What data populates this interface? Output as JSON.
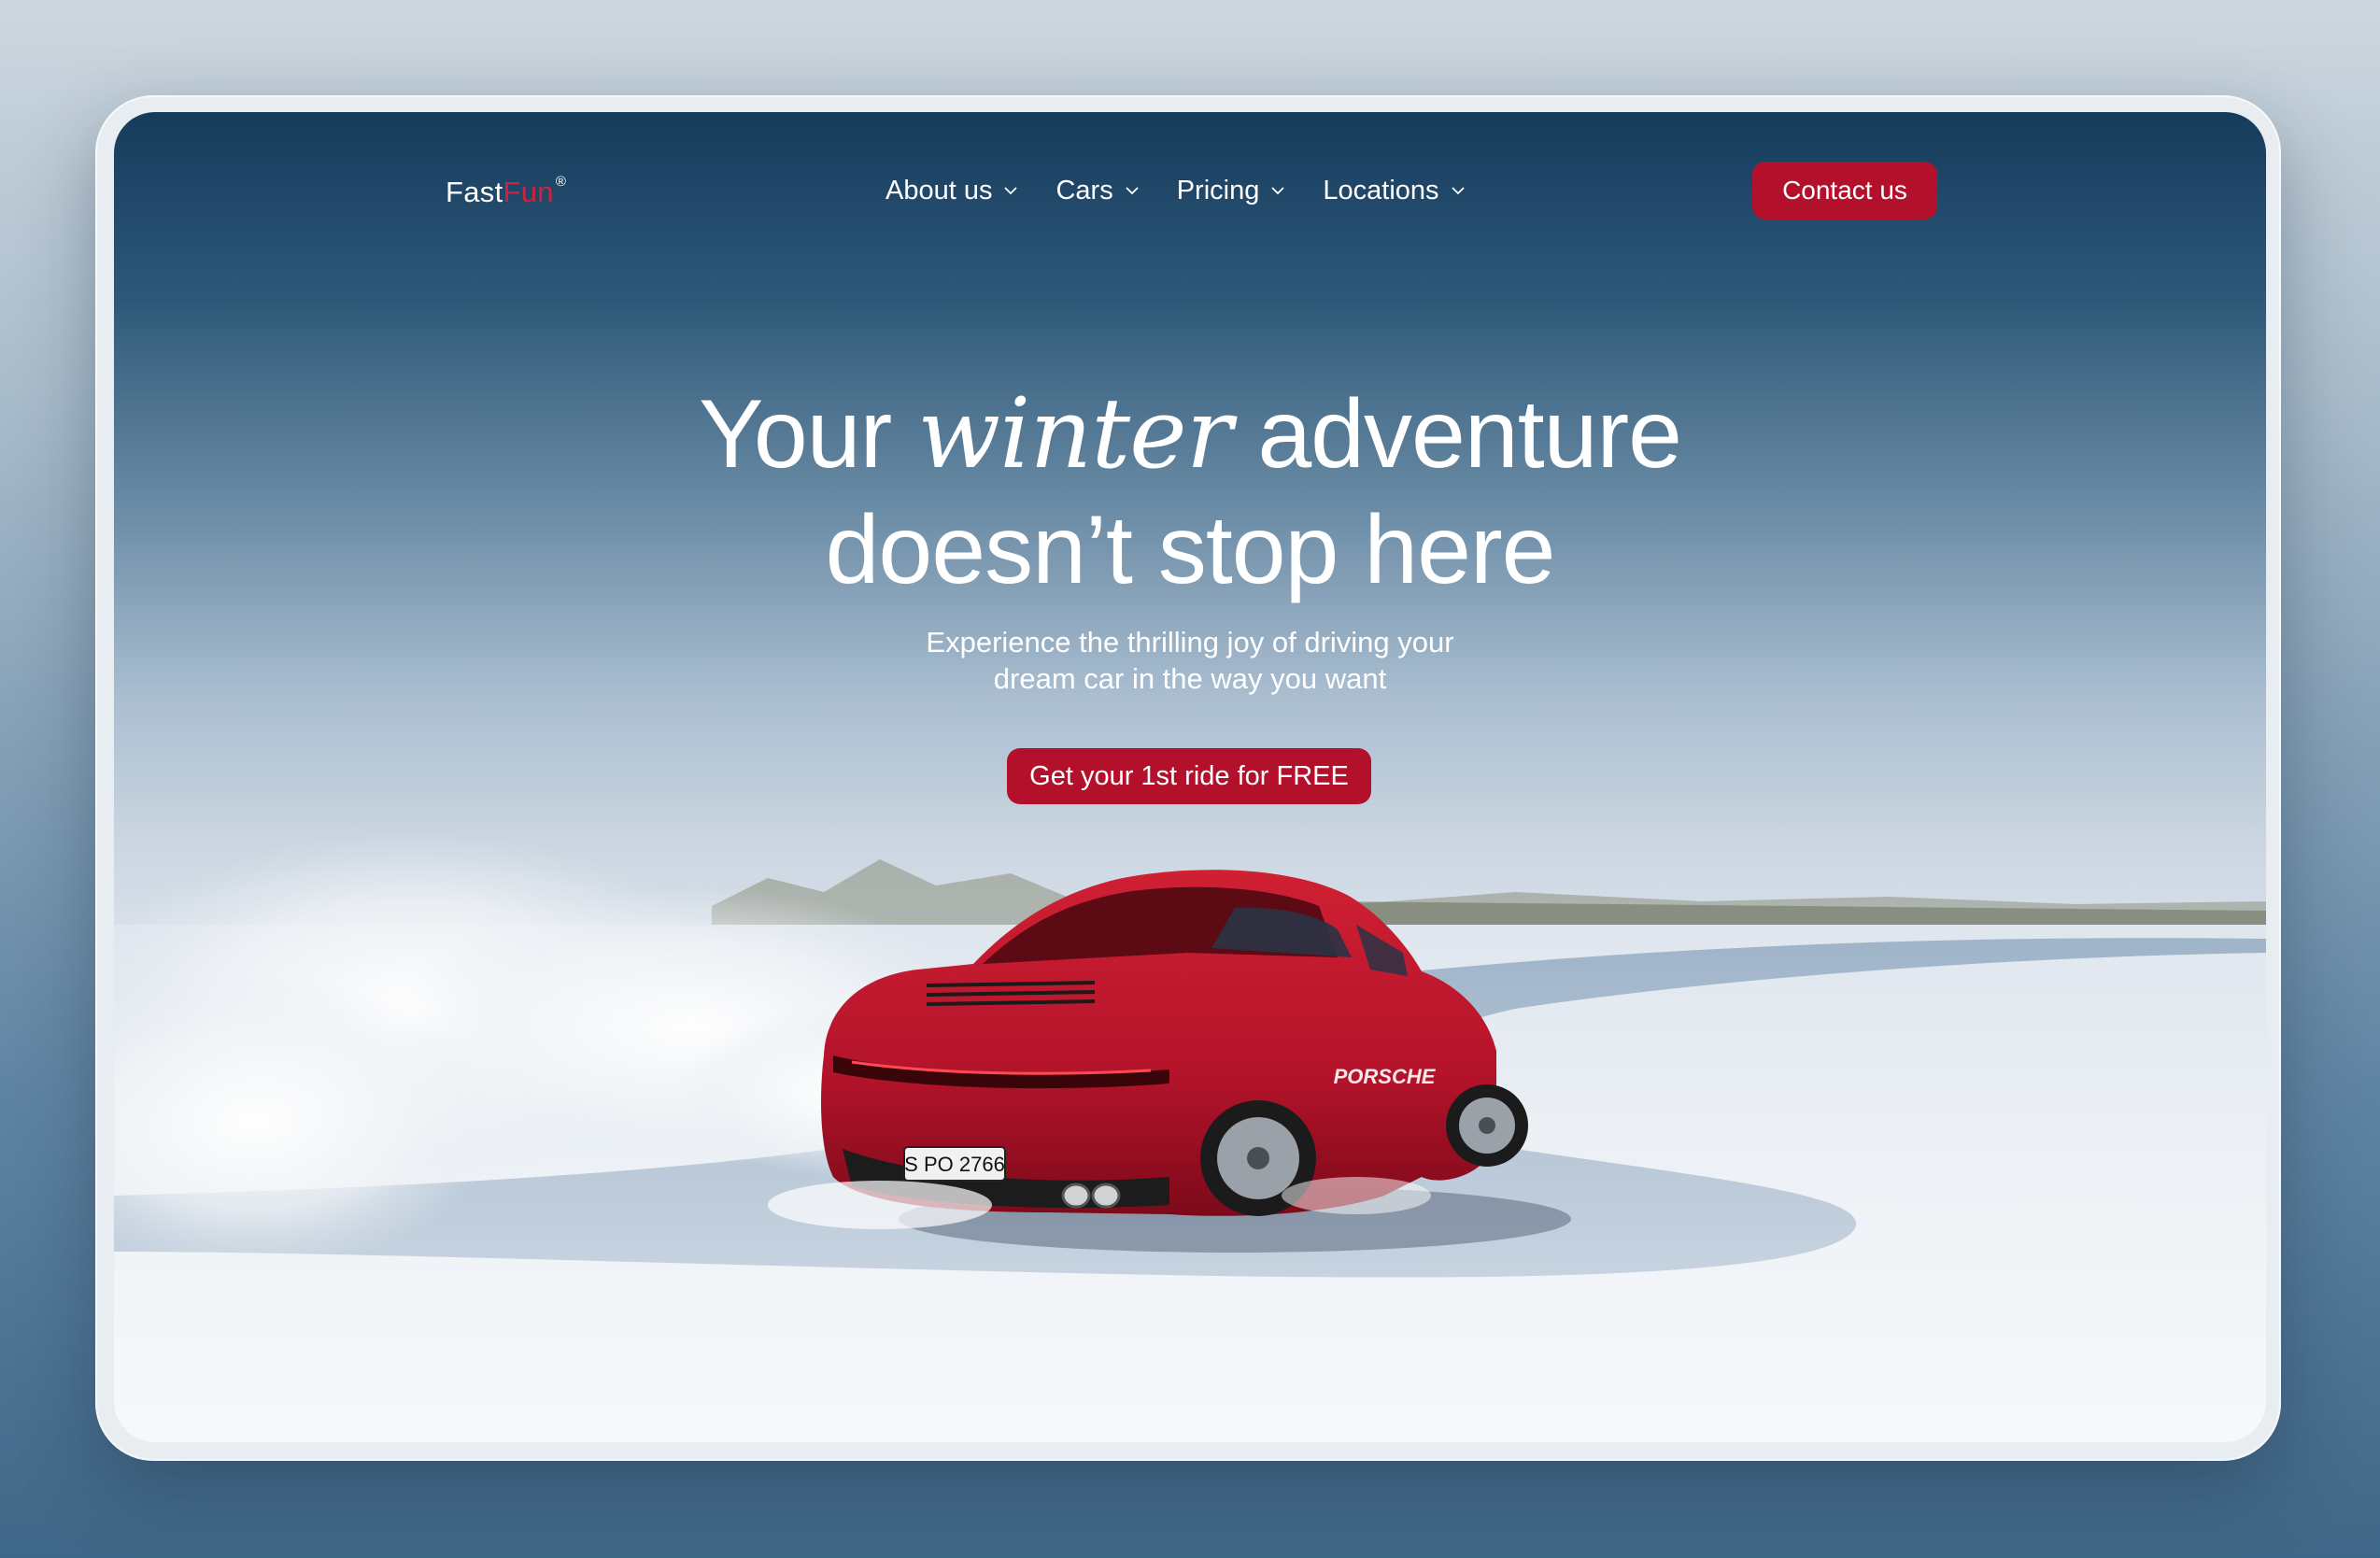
{
  "brand": {
    "name_prefix": "Fast",
    "name_accent": "Fun",
    "mark": "®"
  },
  "nav": {
    "items": [
      {
        "label": "About us"
      },
      {
        "label": "Cars"
      },
      {
        "label": "Pricing"
      },
      {
        "label": "Locations"
      }
    ],
    "contact_label": "Contact us"
  },
  "hero": {
    "title_part1": "Your",
    "title_italic": "winter",
    "title_part2": "adventure",
    "title_line2": "doesn’t stop here",
    "subtitle_line1": "Experience the thrilling joy of driving your",
    "subtitle_line2": "dream car in the way you want",
    "cta_label": "Get your 1st ride for FREE"
  },
  "car": {
    "plate": "S PO 2766",
    "badge": "PORSCHE"
  },
  "colors": {
    "accent": "#b3102b",
    "accent_text": "#d0223d",
    "car_red": "#c4182a"
  },
  "icons": {
    "nav_dropdown": "chevron-down-icon"
  }
}
